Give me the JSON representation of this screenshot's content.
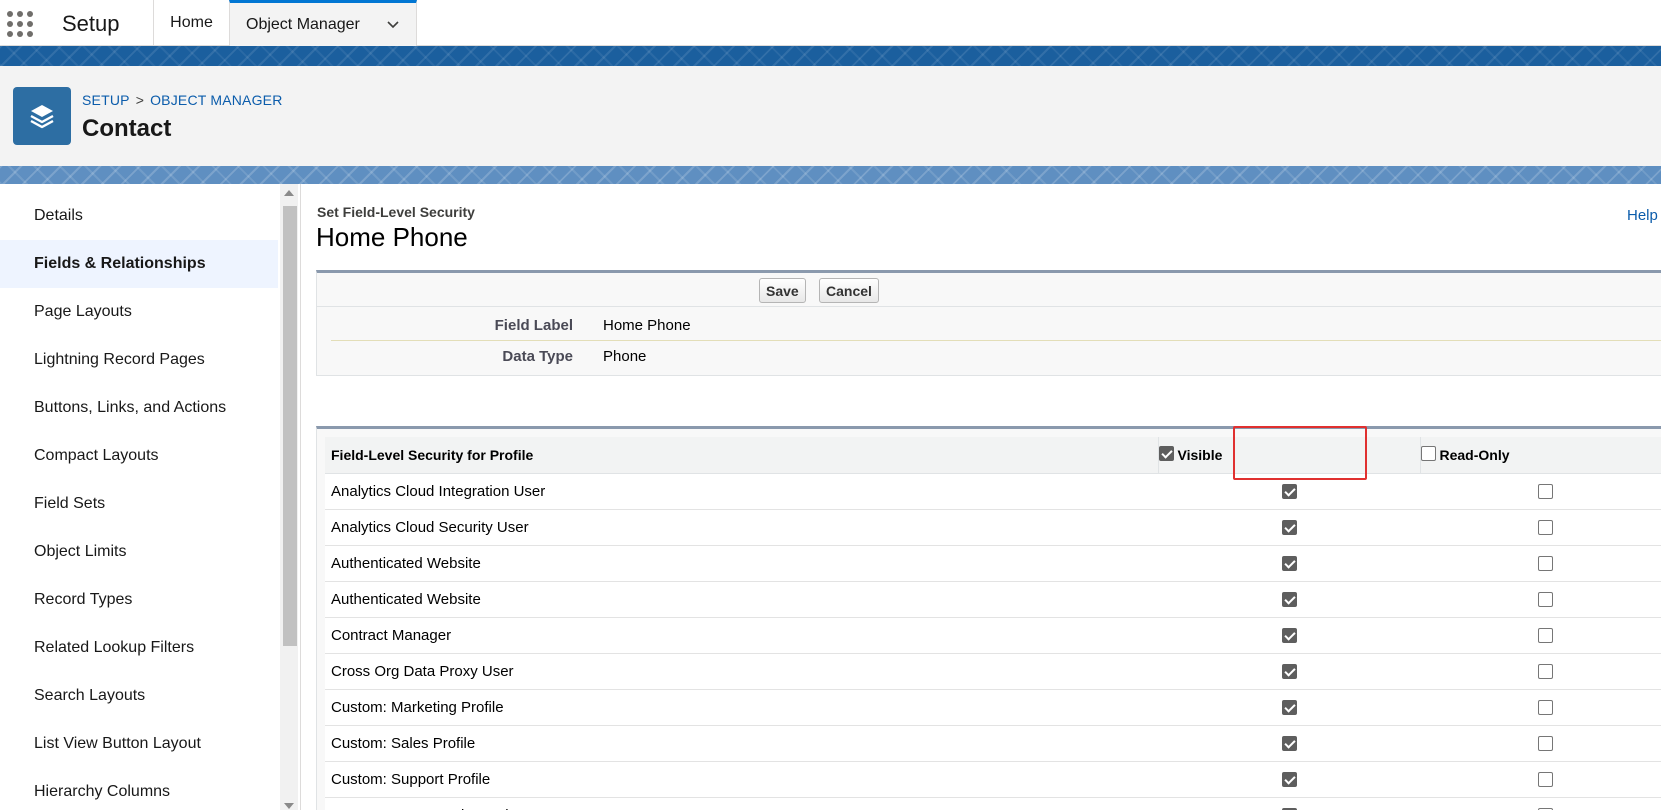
{
  "topnav": {
    "app_name": "Setup",
    "tabs": [
      {
        "label": "Home"
      },
      {
        "label": "Object Manager"
      }
    ]
  },
  "header": {
    "breadcrumb": [
      "SETUP",
      "OBJECT MANAGER"
    ],
    "breadcrumb_separator": ">",
    "title": "Contact",
    "icon": "layers-icon",
    "icon_color": "#2d6ea3"
  },
  "sidebar": {
    "active_item": "Fields & Relationships",
    "items": [
      {
        "label": "Details"
      },
      {
        "label": "Fields & Relationships"
      },
      {
        "label": "Page Layouts"
      },
      {
        "label": "Lightning Record Pages"
      },
      {
        "label": "Buttons, Links, and Actions"
      },
      {
        "label": "Compact Layouts"
      },
      {
        "label": "Field Sets"
      },
      {
        "label": "Object Limits"
      },
      {
        "label": "Record Types"
      },
      {
        "label": "Related Lookup Filters"
      },
      {
        "label": "Search Layouts"
      },
      {
        "label": "List View Button Layout"
      },
      {
        "label": "Hierarchy Columns"
      }
    ]
  },
  "main": {
    "section_label": "Set Field-Level Security",
    "section_title": "Home Phone",
    "help_label": "Help",
    "buttons": {
      "save": "Save",
      "cancel": "Cancel"
    },
    "details": [
      {
        "label": "Field Label",
        "value": "Home Phone"
      },
      {
        "label": "Data Type",
        "value": "Phone"
      }
    ],
    "table": {
      "headers": {
        "profile": "Field-Level Security for Profile",
        "visible": "Visible",
        "read_only": "Read-Only"
      },
      "header_visible_checked": true,
      "header_read_only_checked": false,
      "rows": [
        {
          "profile": "Analytics Cloud Integration User",
          "visible": true,
          "read_only": false
        },
        {
          "profile": "Analytics Cloud Security User",
          "visible": true,
          "read_only": false
        },
        {
          "profile": "Authenticated Website",
          "visible": true,
          "read_only": false
        },
        {
          "profile": "Authenticated Website",
          "visible": true,
          "read_only": false
        },
        {
          "profile": "Contract Manager",
          "visible": true,
          "read_only": false
        },
        {
          "profile": "Cross Org Data Proxy User",
          "visible": true,
          "read_only": false
        },
        {
          "profile": "Custom: Marketing Profile",
          "visible": true,
          "read_only": false
        },
        {
          "profile": "Custom: Sales Profile",
          "visible": true,
          "read_only": false
        },
        {
          "profile": "Custom: Support Profile",
          "visible": true,
          "read_only": false
        },
        {
          "profile": "Customer Community Login User",
          "visible": true,
          "read_only": false
        }
      ]
    }
  },
  "colors": {
    "accent_blue": "#0176d3",
    "link_blue": "#0b5cab",
    "band_blue": "#1b5f9e",
    "highlight_red": "#e0302f"
  }
}
